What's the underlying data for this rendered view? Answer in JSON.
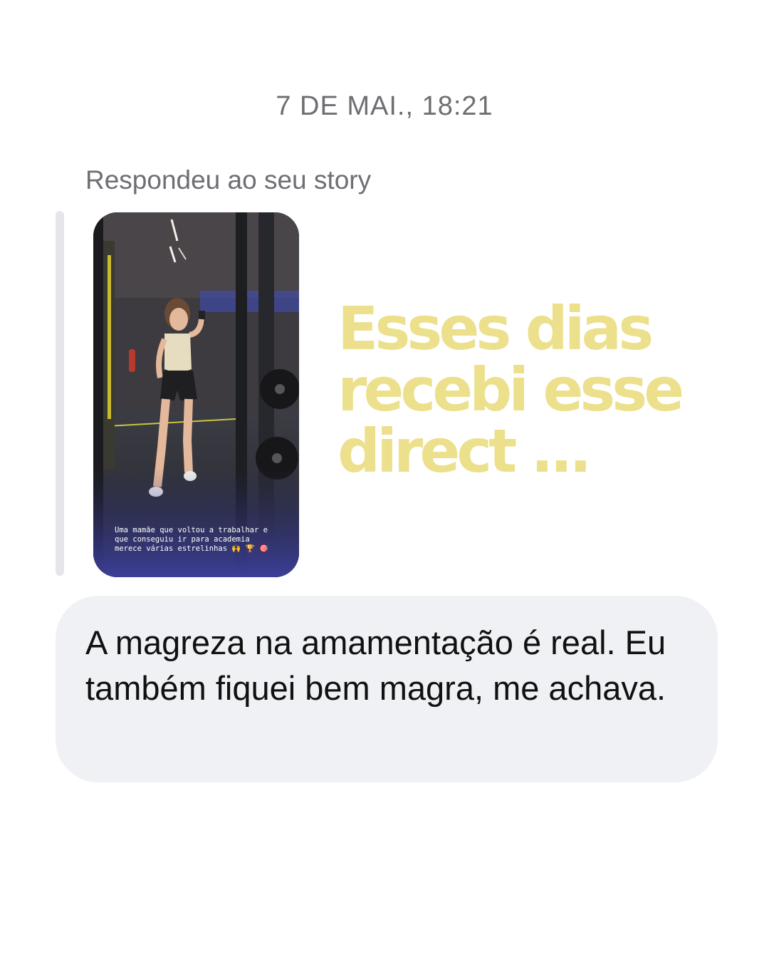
{
  "thread": {
    "timestamp": "7 DE MAI., 18:21",
    "reply_label": "Respondeu ao seu story"
  },
  "story": {
    "caption_lines": [
      "Uma mamãe que voltou a trabalhar e",
      "que conseguiu ir para academia",
      "merece várias estrelinhas 🙌 🏆 🎯"
    ]
  },
  "headline": {
    "lines": [
      "Esses dias",
      "recebi esse",
      "direct ..."
    ],
    "color": "#ece08c"
  },
  "message": {
    "text": "A magreza na amamentação é real. Eu também fiquei bem magra, me achava."
  },
  "colors": {
    "bubble_bg": "#f0f1f4",
    "meta_text": "#6e6e73",
    "quote_bar": "#e5e6ea"
  }
}
